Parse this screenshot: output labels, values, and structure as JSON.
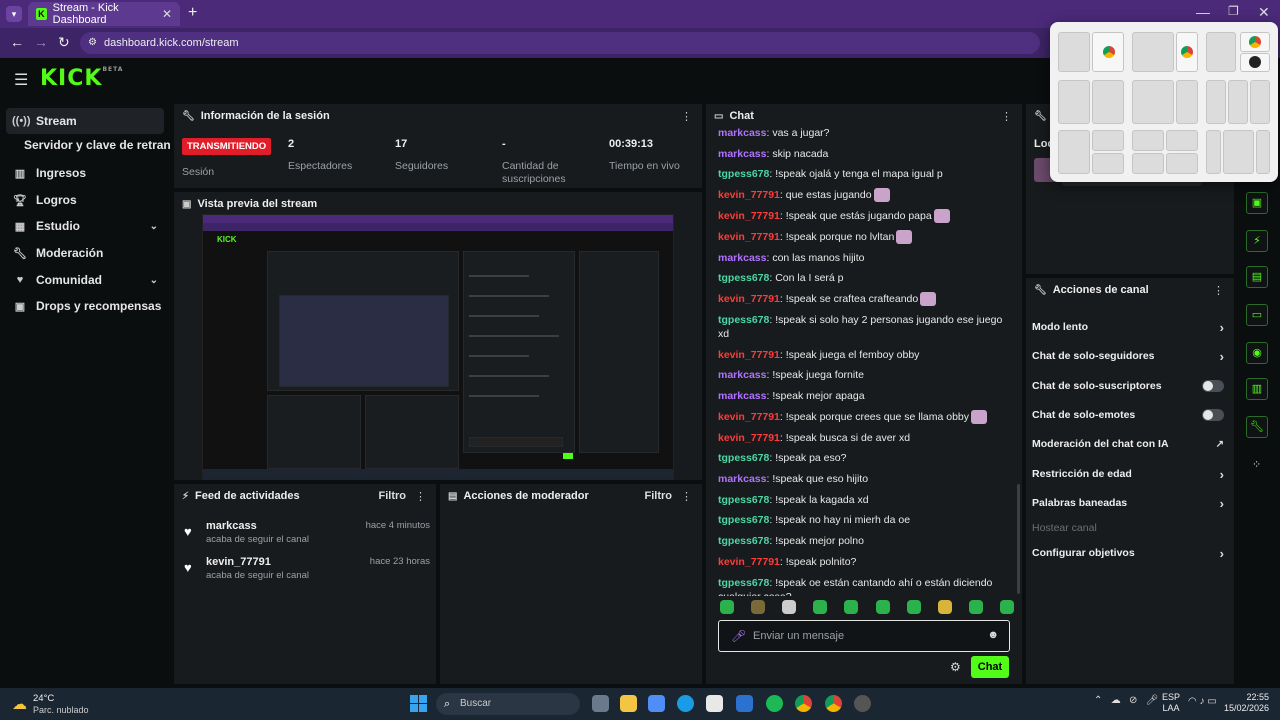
{
  "browser": {
    "tab_title": "Stream - Kick Dashboard",
    "url": "dashboard.kick.com/stream"
  },
  "header": {
    "logo": "KICK",
    "logo_badge": "BETA"
  },
  "sidebar": {
    "items": [
      {
        "label": "Stream",
        "icon": "broadcast-icon"
      },
      {
        "label": "Servidor y clave de retransmisión",
        "icon": ""
      },
      {
        "label": "Ingresos",
        "icon": "chart-icon"
      },
      {
        "label": "Logros",
        "icon": "trophy-icon"
      },
      {
        "label": "Estudio",
        "icon": "studio-icon"
      },
      {
        "label": "Moderación",
        "icon": "wrench-icon"
      },
      {
        "label": "Comunidad",
        "icon": "community-icon"
      },
      {
        "label": "Drops y recompensas",
        "icon": "gift-icon"
      }
    ]
  },
  "session": {
    "title": "Información de la sesión",
    "badge": "TRANSMITIENDO",
    "badge_label": "Sesión",
    "stats": [
      {
        "value": "2",
        "label": "Espectadores"
      },
      {
        "value": "17",
        "label": "Seguidores"
      },
      {
        "value": "-",
        "label": "Cantidad de suscripciones"
      },
      {
        "value": "00:39:13",
        "label": "Tiempo en vivo"
      }
    ]
  },
  "preview": {
    "title": "Vista previa del stream"
  },
  "activity": {
    "title": "Feed de actividades",
    "filter": "Filtro",
    "items": [
      {
        "user": "markcass",
        "time": "hace 4 minutos",
        "sub": "acaba de seguir el canal"
      },
      {
        "user": "kevin_77791",
        "time": "hace 23 horas",
        "sub": "acaba de seguir el canal"
      }
    ]
  },
  "modactions": {
    "title": "Acciones de moderador",
    "filter": "Filtro"
  },
  "chat": {
    "title": "Chat",
    "messages": [
      {
        "user": "markcass",
        "color": "purple",
        "text": "vas a jugar?"
      },
      {
        "user": "markcass",
        "color": "purple",
        "text": "skip nacada"
      },
      {
        "user": "tgpess678",
        "color": "teal",
        "text": "!speak ojalá y tenga el mapa igual p"
      },
      {
        "user": "kevin_77791",
        "color": "red",
        "text": "que estas jugando",
        "emote": true
      },
      {
        "user": "kevin_77791",
        "color": "red",
        "text": "!speak que estás jugando papa",
        "emote": true
      },
      {
        "user": "kevin_77791",
        "color": "red",
        "text": "!speak porque no lvltan",
        "emote": true
      },
      {
        "user": "markcass",
        "color": "purple",
        "text": "con las manos hijito"
      },
      {
        "user": "tgpess678",
        "color": "teal",
        "text": "Con la I será p"
      },
      {
        "user": "kevin_77791",
        "color": "red",
        "text": "!speak se craftea crafteando",
        "emote": true
      },
      {
        "user": "tgpess678",
        "color": "teal",
        "text": "!speak si solo hay 2 personas jugando ese juego xd"
      },
      {
        "user": "kevin_77791",
        "color": "red",
        "text": "!speak juega el femboy obby"
      },
      {
        "user": "markcass",
        "color": "purple",
        "text": "!speak juega fornite"
      },
      {
        "user": "markcass",
        "color": "purple",
        "text": "!speak mejor apaga"
      },
      {
        "user": "kevin_77791",
        "color": "red",
        "text": "!speak porque crees que se llama obby",
        "emote": true
      },
      {
        "user": "kevin_77791",
        "color": "red",
        "text": "!speak busca si de aver xd"
      },
      {
        "user": "tgpess678",
        "color": "teal",
        "text": "!speak pa eso?"
      },
      {
        "user": "markcass",
        "color": "purple",
        "text": "!speak que eso hijito"
      },
      {
        "user": "tgpess678",
        "color": "teal",
        "text": "!speak la kagada xd"
      },
      {
        "user": "tgpess678",
        "color": "teal",
        "text": "!speak no hay ni mierh da oe"
      },
      {
        "user": "tgpess678",
        "color": "teal",
        "text": "!speak mejor polno"
      },
      {
        "user": "kevin_77791",
        "color": "red",
        "text": "!speak polnito?"
      },
      {
        "user": "tgpess678",
        "color": "teal",
        "text": "!speak oe están cantando ahí o están diciendo cualquier cosa?"
      }
    ],
    "input_placeholder": "Enviar un mensaje",
    "send_label": "Chat"
  },
  "info_panel": {
    "title": "In",
    "loc_label": "Loc"
  },
  "channel_actions": {
    "title": "Acciones de canal",
    "items": [
      {
        "label": "Modo lento",
        "control": "chevron"
      },
      {
        "label": "Chat de solo-seguidores",
        "control": "chevron"
      },
      {
        "label": "Chat de solo-suscriptores",
        "control": "toggle"
      },
      {
        "label": "Chat de solo-emotes",
        "control": "toggle"
      },
      {
        "label": "Moderación del chat con IA",
        "control": "external"
      },
      {
        "label": "Restricción de edad",
        "control": "chevron"
      },
      {
        "label": "Palabras baneadas",
        "control": "chevron"
      },
      {
        "label": "Hostear canal",
        "control": "disabled"
      },
      {
        "label": "Configurar objetivos",
        "control": "chevron"
      }
    ]
  },
  "taskbar": {
    "temp": "24°C",
    "weather": "Parc. nublado",
    "search": "Buscar",
    "lang1": "ESP",
    "lang2": "LAA",
    "time": "22:55",
    "date": "15/02/2026"
  },
  "colors": {
    "accent": "#53fc18",
    "live": "#e11d2a",
    "panel": "#181b1d"
  }
}
